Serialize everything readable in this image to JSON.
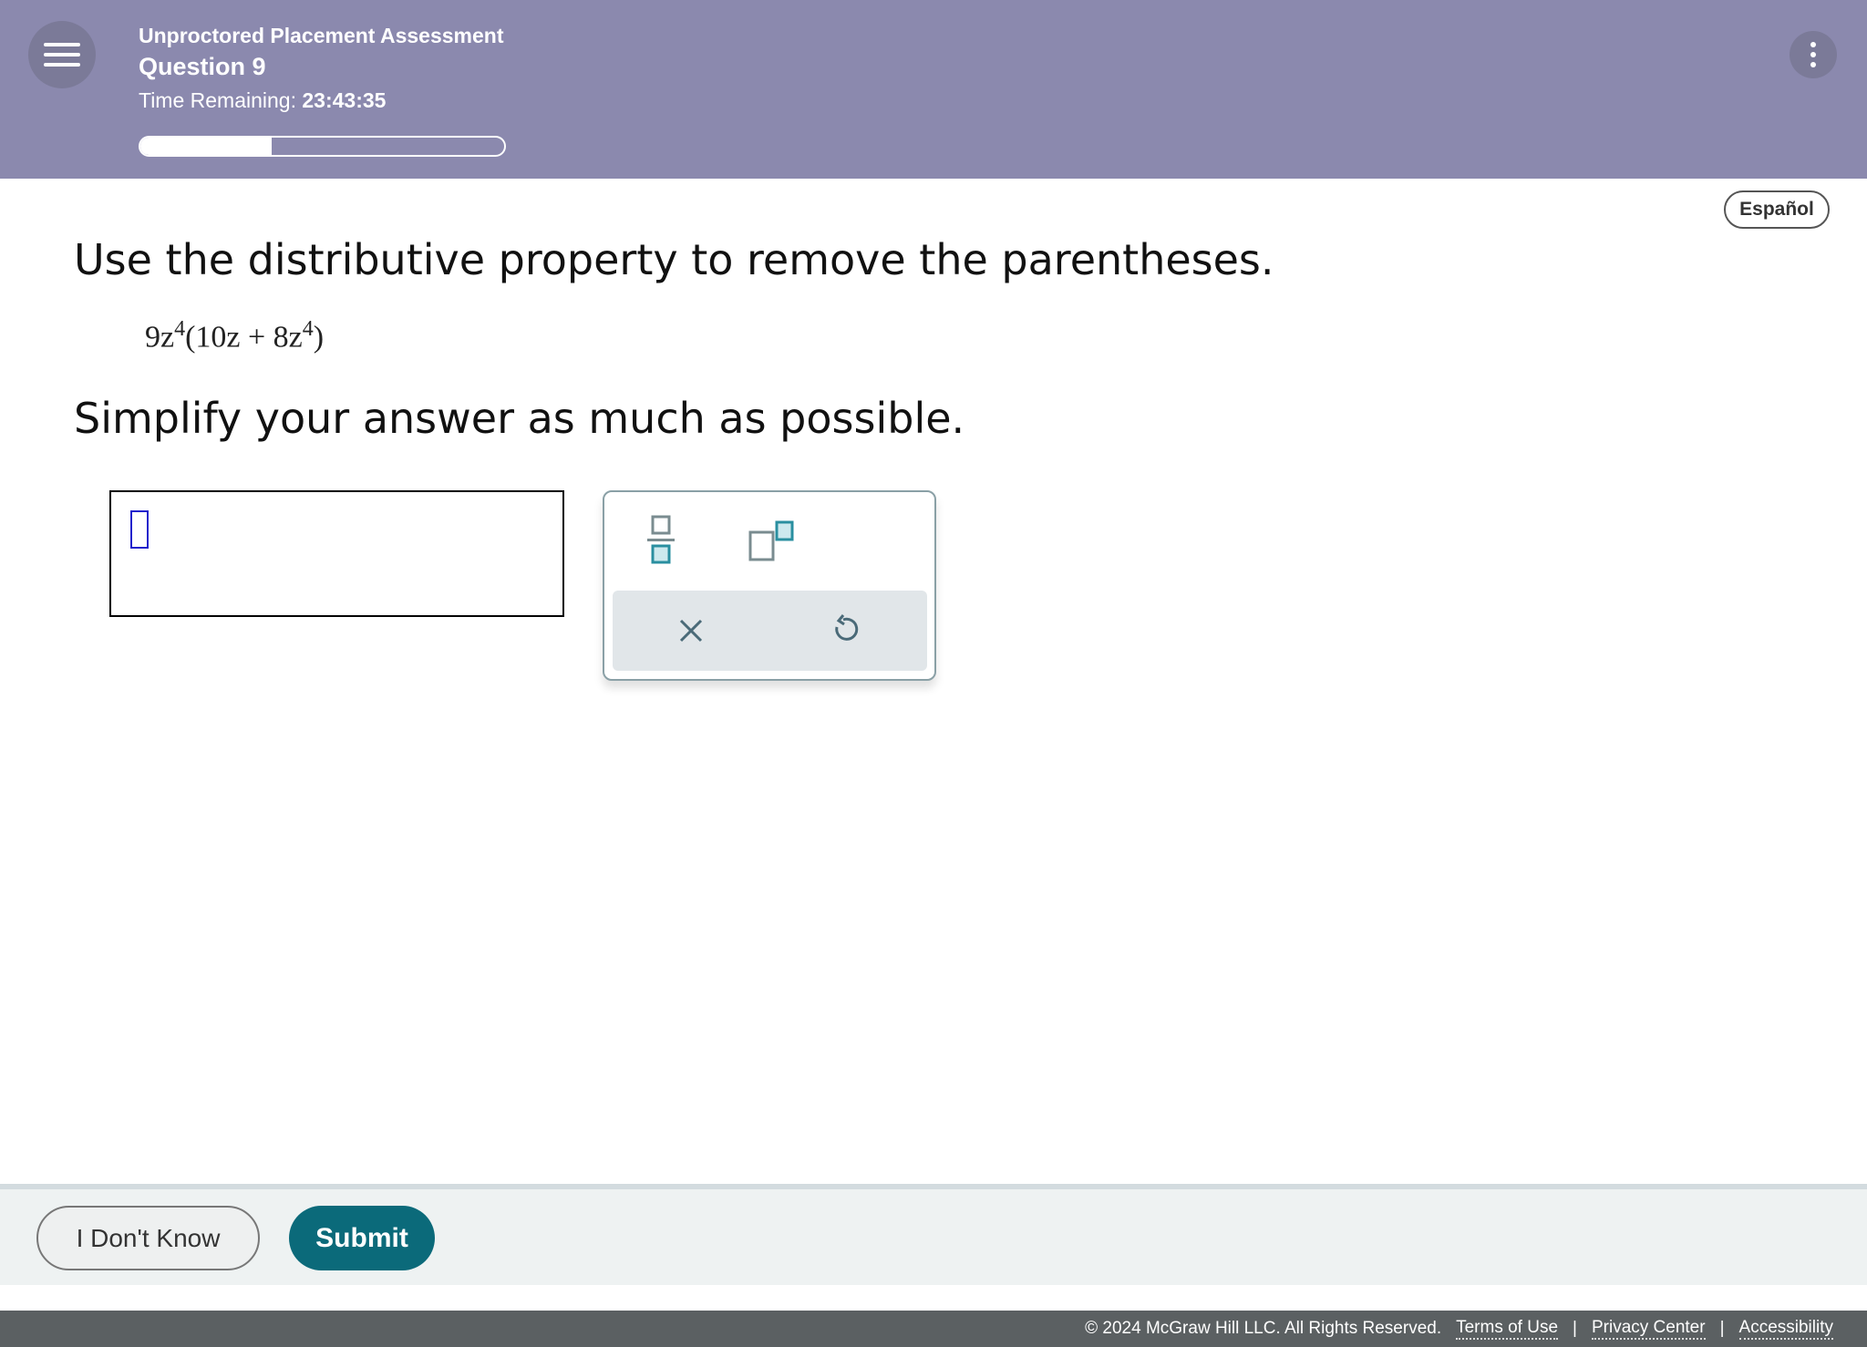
{
  "header": {
    "title": "Unproctored Placement Assessment",
    "question": "Question 9",
    "time_label": "Time Remaining:",
    "time_value": "23:43:35",
    "progress_percent": 36
  },
  "language_button": "Español",
  "question": {
    "instruction": "Use the distributive property to remove the parentheses.",
    "expression": {
      "coef": "9z",
      "exp1": "4",
      "inner_a": "(10z + 8z",
      "exp2": "4",
      "close": ")"
    },
    "followup": "Simplify your answer as much as possible."
  },
  "answer": {
    "value": ""
  },
  "palette": {
    "tools": [
      "fraction-icon",
      "superscript-icon",
      "clear-icon",
      "undo-icon"
    ]
  },
  "actions": {
    "dont_know": "I Don't Know",
    "submit": "Submit"
  },
  "footer": {
    "copyright": "© 2024 McGraw Hill LLC. All Rights Reserved.",
    "links": [
      "Terms of Use",
      "Privacy Center",
      "Accessibility"
    ],
    "separator": "|"
  },
  "colors": {
    "header": "#8b89ae",
    "submit": "#0b6a7a",
    "footer": "#5b6062"
  }
}
